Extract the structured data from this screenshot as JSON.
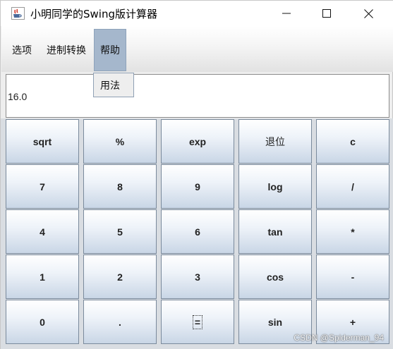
{
  "window": {
    "title": "小明同学的Swing版计算器"
  },
  "menubar": {
    "items": [
      {
        "label": "选项"
      },
      {
        "label": "进制转换"
      },
      {
        "label": "帮助"
      }
    ],
    "open_menu": {
      "items": [
        {
          "label": "用法"
        }
      ]
    }
  },
  "display": {
    "value": "16.0"
  },
  "keypad": {
    "rows": [
      [
        "sqrt",
        "%",
        "exp",
        "退位",
        "c"
      ],
      [
        "7",
        "8",
        "9",
        "log",
        "/"
      ],
      [
        "4",
        "5",
        "6",
        "tan",
        "*"
      ],
      [
        "1",
        "2",
        "3",
        "cos",
        "-"
      ],
      [
        "0",
        ".",
        "=",
        "sin",
        "+"
      ]
    ]
  },
  "watermark": "CSDN @Spiderman_94",
  "colors": {
    "menu_highlight": "#a5b7cc",
    "key_gradient_top": "#ffffff",
    "key_gradient_bottom": "#c9d6e6"
  },
  "icons": {
    "app": "java-coffee-cup-icon",
    "minimize": "minimize-icon",
    "maximize": "maximize-icon",
    "close": "close-icon"
  }
}
